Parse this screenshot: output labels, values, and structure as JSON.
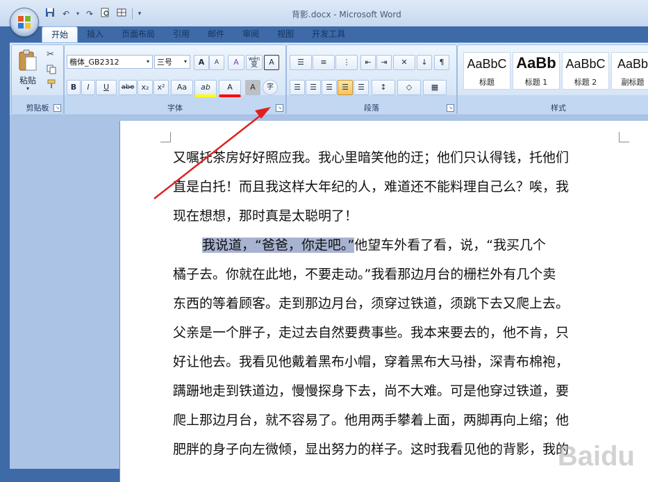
{
  "window": {
    "title": "背影.docx - Microsoft Word"
  },
  "ribbon": {
    "tabs": [
      "开始",
      "插入",
      "页面布局",
      "引用",
      "邮件",
      "审阅",
      "视图",
      "开发工具"
    ],
    "clipboard": {
      "paste_label": "粘贴",
      "group_label": "剪贴板"
    },
    "font": {
      "name": "楷体_GB2312",
      "size": "三号",
      "group_label": "字体",
      "bold": "B",
      "italic": "I",
      "underline": "U",
      "strike": "abe",
      "subscript": "x₂",
      "superscript": "x²",
      "change_case": "Aa",
      "grow": "A",
      "shrink": "A",
      "clear_format": "A",
      "char_shading": "A",
      "enclose": "字",
      "phonetic": "wén",
      "phonetic2": "变",
      "highlight": "ab",
      "font_color": "A",
      "border": "A"
    },
    "paragraph": {
      "group_label": "段落"
    },
    "styles": {
      "group_label": "样式",
      "items": [
        {
          "sample": "AaBbC",
          "name": "标题"
        },
        {
          "sample": "AaBb",
          "name": "标题 1"
        },
        {
          "sample": "AaBbC",
          "name": "标题 2"
        },
        {
          "sample": "AaBb",
          "name": "副标题"
        }
      ]
    }
  },
  "document": {
    "lines": [
      "又嘱托茶房好好照应我。我心里暗笑他的迂；他们只认得钱，托他们",
      "直是白托！而且我这样大年纪的人，难道还不能料理自己么？唉，我",
      "现在想想，那时真是太聪明了！"
    ],
    "selected": "我说道，“爸爸，你走吧。”",
    "after_selected": "他望车外看了看，说，“我买几个",
    "lines2": [
      "橘子去。你就在此地，不要走动。”我看那边月台的栅栏外有几个卖",
      "东西的等着顾客。走到那边月台，须穿过铁道，须跳下去又爬上去。",
      "父亲是一个胖子，走过去自然要费事些。我本来要去的，他不肯，只",
      "好让他去。我看见他戴着黑布小帽，穿着黑布大马褂，深青布棉袍，",
      "蹒跚地走到铁道边，慢慢探身下去，尚不大难。可是他穿过铁道，要",
      "爬上那边月台，就不容易了。他用两手攀着上面，两脚再向上缩；他",
      "肥胖的身子向左微倾，显出努力的样子。这时我看见他的背影，我的"
    ]
  },
  "watermark": "Baidu",
  "annotation": {
    "arrow_color": "#e02020"
  }
}
